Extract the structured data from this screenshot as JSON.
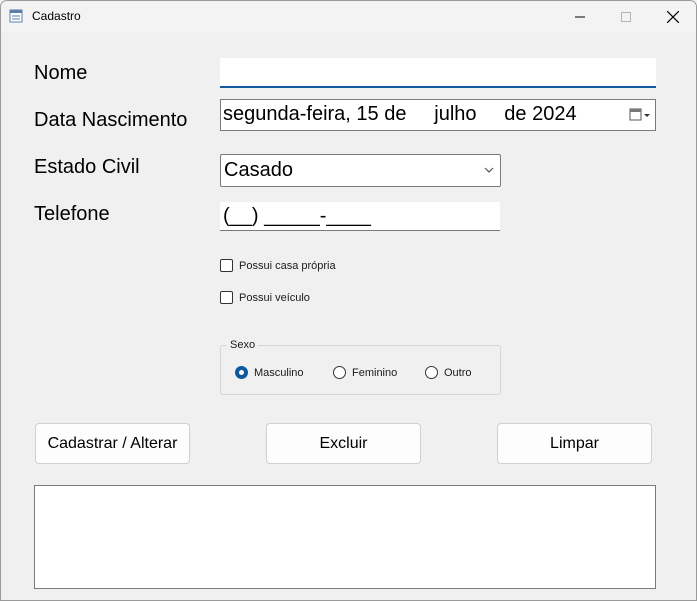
{
  "window": {
    "title": "Cadastro"
  },
  "form": {
    "nome_label": "Nome",
    "nome_value": "",
    "data_label": "Data Nascimento",
    "data_value": "segunda-feira, 15 de     julho     de 2024",
    "estado_civil_label": "Estado Civil",
    "estado_civil_value": "Casado",
    "telefone_label": "Telefone",
    "telefone_value": "(__) _____-____",
    "casa_propria_label": "Possui casa própria",
    "veiculo_label": "Possui veículo",
    "sexo": {
      "legend": "Sexo",
      "options": [
        "Masculino",
        "Feminino",
        "Outro"
      ],
      "selected": "Masculino"
    }
  },
  "buttons": {
    "cadastrar": "Cadastrar / Alterar",
    "excluir": "Excluir",
    "limpar": "Limpar"
  },
  "colors": {
    "accent": "#0f5a9e",
    "background": "#f0f0f0"
  }
}
